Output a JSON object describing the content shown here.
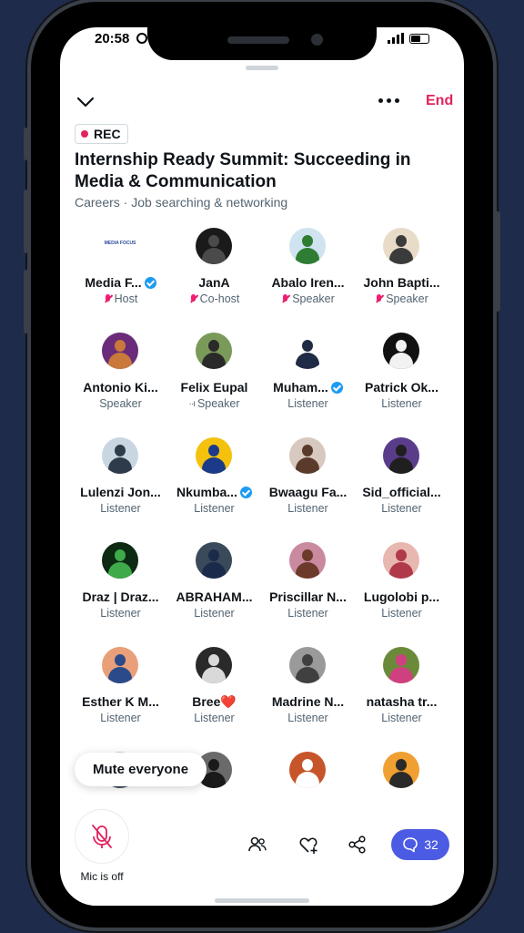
{
  "status": {
    "time": "20:58"
  },
  "header": {
    "end_label": "End"
  },
  "space": {
    "rec_label": "REC",
    "title": "Internship Ready Summit: Succeeding in Media & Communication",
    "subtitle": "Careers · Job searching & networking"
  },
  "participants": [
    {
      "name": "Media F...",
      "role": "Host",
      "verified": true,
      "mic_icon": true,
      "avatar_bg": "#ffffff",
      "avatar_fg": "#2b4a9c",
      "logo_text": "MEDIA FOCUS"
    },
    {
      "name": "JanA",
      "role": "Co-host",
      "verified": false,
      "mic_icon": true,
      "avatar_bg": "#1a1a1a",
      "avatar_fg": "#4a4a4a"
    },
    {
      "name": "Abalo Iren...",
      "role": "Speaker",
      "verified": false,
      "mic_icon": true,
      "avatar_bg": "#cfe3f1",
      "avatar_fg": "#2e7d32"
    },
    {
      "name": "John Bapti...",
      "role": "Speaker",
      "verified": false,
      "mic_icon": true,
      "avatar_bg": "#e8dcc8",
      "avatar_fg": "#3b3b3b"
    },
    {
      "name": "Antonio Ki...",
      "role": "Speaker",
      "verified": false,
      "mic_icon": false,
      "avatar_bg": "#6a2c7a",
      "avatar_fg": "#c97a3a"
    },
    {
      "name": "Felix Eupal",
      "role": "Speaker",
      "verified": false,
      "mic_icon": false,
      "level": "··ı",
      "avatar_bg": "#7a9a5a",
      "avatar_fg": "#2a2a2a"
    },
    {
      "name": "Muham...",
      "role": "Listener",
      "verified": true,
      "mic_icon": false,
      "avatar_bg": "#ffffff",
      "avatar_fg": "#1f2a44"
    },
    {
      "name": "Patrick Ok...",
      "role": "Listener",
      "verified": false,
      "mic_icon": false,
      "avatar_bg": "#111111",
      "avatar_fg": "#f2f2f2"
    },
    {
      "name": "Lulenzi Jon...",
      "role": "Listener",
      "verified": false,
      "mic_icon": false,
      "avatar_bg": "#c9d6e2",
      "avatar_fg": "#2d3b4a"
    },
    {
      "name": "Nkumba...",
      "role": "Listener",
      "verified": true,
      "mic_icon": false,
      "avatar_bg": "#f4c20d",
      "avatar_fg": "#1b3a8a"
    },
    {
      "name": "Bwaagu Fa...",
      "role": "Listener",
      "verified": false,
      "mic_icon": false,
      "avatar_bg": "#d8c9c0",
      "avatar_fg": "#5a3a2a"
    },
    {
      "name": "Sid_official...",
      "role": "Listener",
      "verified": false,
      "mic_icon": false,
      "avatar_bg": "#5a3d8a",
      "avatar_fg": "#1f1f1f"
    },
    {
      "name": "Draz | Draz...",
      "role": "Listener",
      "verified": false,
      "mic_icon": false,
      "avatar_bg": "#0d2a12",
      "avatar_fg": "#3faa4a"
    },
    {
      "name": "ABRAHAM...",
      "role": "Listener",
      "verified": false,
      "mic_icon": false,
      "avatar_bg": "#3a4a5a",
      "avatar_fg": "#1a2a4a"
    },
    {
      "name": "Priscillar N...",
      "role": "Listener",
      "verified": false,
      "mic_icon": false,
      "avatar_bg": "#c98aa0",
      "avatar_fg": "#6b3a2a"
    },
    {
      "name": "Lugolobi p...",
      "role": "Listener",
      "verified": false,
      "mic_icon": false,
      "avatar_bg": "#e7b7b0",
      "avatar_fg": "#b03a4a"
    },
    {
      "name": "Esther K M...",
      "role": "Listener",
      "verified": false,
      "mic_icon": false,
      "avatar_bg": "#e9a07a",
      "avatar_fg": "#2b4a8a"
    },
    {
      "name": "Bree❤️",
      "role": "Listener",
      "verified": false,
      "mic_icon": false,
      "avatar_bg": "#2a2a2a",
      "avatar_fg": "#d9d9d9"
    },
    {
      "name": "Madrine N...",
      "role": "Listener",
      "verified": false,
      "mic_icon": false,
      "avatar_bg": "#9a9a9a",
      "avatar_fg": "#404040"
    },
    {
      "name": "natasha tr...",
      "role": "Listener",
      "verified": false,
      "mic_icon": false,
      "avatar_bg": "#6a8a3a",
      "avatar_fg": "#d04080"
    },
    {
      "name": "",
      "role": "",
      "verified": false,
      "mic_icon": false,
      "avatar_bg": "#c9d6e2",
      "avatar_fg": "#3a4a5a"
    },
    {
      "name": "",
      "role": "",
      "verified": false,
      "mic_icon": false,
      "avatar_bg": "#6a6a6a",
      "avatar_fg": "#1a1a1a"
    },
    {
      "name": "",
      "role": "",
      "verified": false,
      "mic_icon": false,
      "avatar_bg": "#c7552a",
      "avatar_fg": "#ffffff"
    },
    {
      "name": "",
      "role": "",
      "verified": false,
      "mic_icon": false,
      "avatar_bg": "#f0a030",
      "avatar_fg": "#2a2a2a"
    }
  ],
  "mute_everyone_label": "Mute everyone",
  "bottom": {
    "mic_label": "Mic is off",
    "chat_count": "32"
  },
  "colors": {
    "end": "#e0245e",
    "rec_dot": "#e0245e",
    "chat_button": "#4c5be3",
    "verified": "#1d9bf0",
    "mic_icon": "#f91880"
  }
}
